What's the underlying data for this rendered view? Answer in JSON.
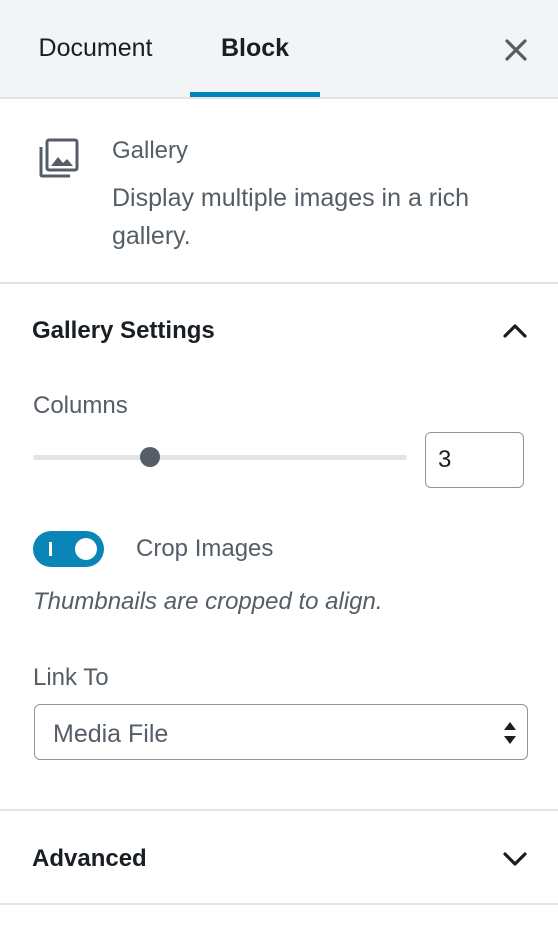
{
  "tabs": {
    "document_label": "Document",
    "block_label": "Block",
    "active": "Block"
  },
  "icons": {
    "close": "close-icon",
    "block": "gallery-icon",
    "collapse": "chevron-up-icon",
    "expand": "chevron-down-icon",
    "select": "select-arrows-icon"
  },
  "block_card": {
    "title": "Gallery",
    "description": "Display multiple images in a rich gallery."
  },
  "gallery_settings": {
    "title": "Gallery Settings",
    "expanded": true,
    "columns": {
      "label": "Columns",
      "value": "3",
      "min": 1,
      "max": 8
    },
    "crop_images": {
      "label": "Crop Images",
      "checked": true,
      "help": "Thumbnails are cropped to align."
    },
    "link_to": {
      "label": "Link To",
      "value": "Media File"
    }
  },
  "advanced": {
    "title": "Advanced",
    "expanded": false
  },
  "colors": {
    "accent": "#0085ba",
    "toggle_on": "#0a85b7",
    "header_bg": "#f3f4f5",
    "border": "#e2e4e7",
    "text_muted": "#555d66"
  }
}
